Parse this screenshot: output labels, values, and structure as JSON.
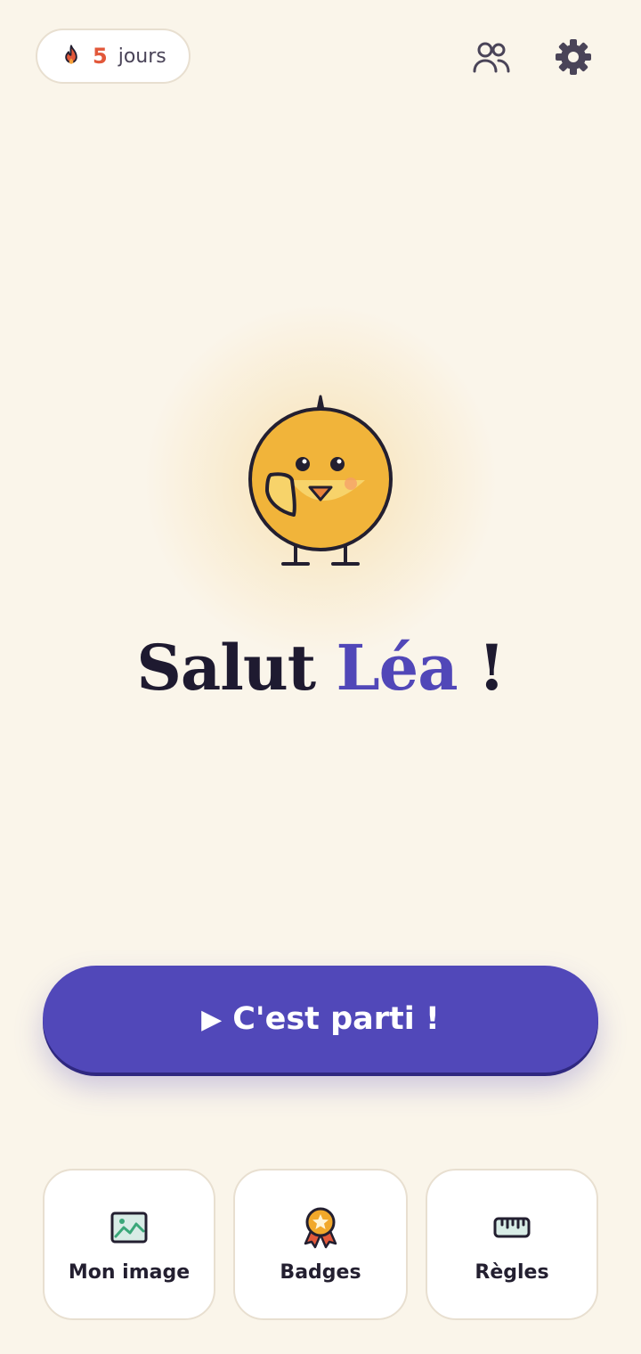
{
  "header": {
    "streak": {
      "count": "5",
      "unit": "jours",
      "icon": "flame-icon"
    },
    "friends_icon": "people-icon",
    "settings_icon": "gear-icon"
  },
  "mascot": {
    "icon": "chick-mascot"
  },
  "greeting": {
    "prefix": "Salut",
    "name": "Léa",
    "suffix": "!"
  },
  "cta": {
    "play_glyph": "▶",
    "label": "C'est parti !"
  },
  "cards": [
    {
      "label": "Mon image",
      "icon": "image-icon"
    },
    {
      "label": "Badges",
      "icon": "medal-icon"
    },
    {
      "label": "Règles",
      "icon": "ruler-icon"
    }
  ],
  "colors": {
    "background": "#faf5ea",
    "accent": "#5148b9",
    "streak": "#e2583a",
    "text": "#1e1a30"
  }
}
